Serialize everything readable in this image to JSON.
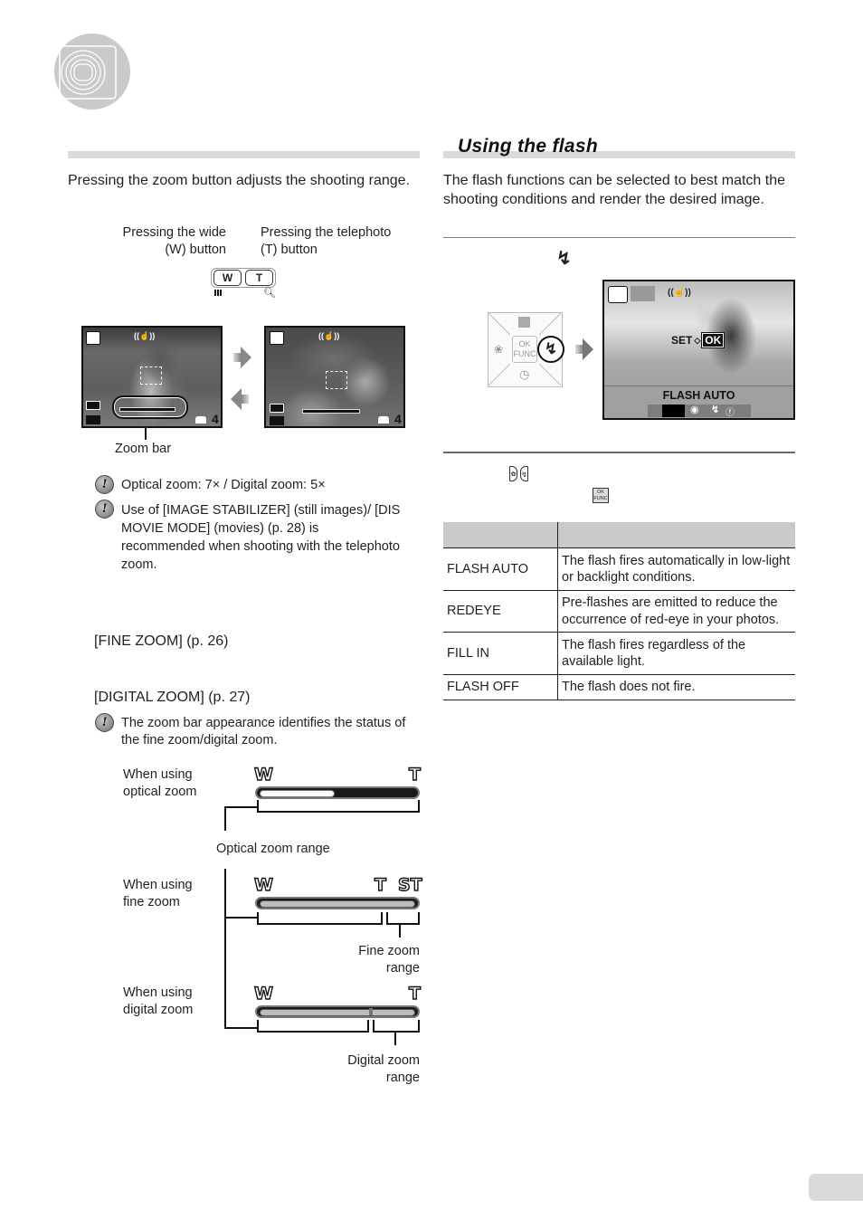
{
  "page": {
    "chapter_icon": "camera-lens-icon",
    "page_tab": ""
  },
  "left": {
    "intro": "Pressing the zoom button adjusts the shooting range.",
    "wide_caption_line1": "Pressing the wide",
    "wide_caption_line2": "(W) button",
    "tele_caption_line1": "Pressing the telephoto",
    "tele_caption_line2": "(T) button",
    "w_key": "W",
    "t_key": "T",
    "screen_count_1": "4",
    "screen_count_2": "4",
    "zoom_bar_label": "Zoom bar",
    "notes": [
      "Optical zoom: 7× / Digital zoom: 5×",
      "Use of [IMAGE STABILIZER] (still images)/ [DIS MOVIE MODE] (movies) (p. 28) is recommended when shooting with the telephoto zoom."
    ],
    "fine_zoom_ref": "[FINE ZOOM] (p. 26)",
    "digital_zoom_ref": "[DIGITAL ZOOM] (p. 27)",
    "zoom_bar_note": "The zoom bar appearance identifies the status of the fine zoom/digital zoom.",
    "diagram": {
      "optical_label_1": "When using",
      "optical_label_2": "optical zoom",
      "optical_range": "Optical zoom range",
      "fine_label_1": "When using",
      "fine_label_2": "fine zoom",
      "fine_range_1": "Fine zoom",
      "fine_range_2": "range",
      "digital_label_1": "When using",
      "digital_label_2": "digital zoom",
      "digital_range_1": "Digital zoom",
      "digital_range_2": "range",
      "w": "W",
      "t": "T",
      "st": "ST",
      "optical_fill_fraction": 0.47
    }
  },
  "right": {
    "title": "Using the flash",
    "intro": "The flash functions can be selected to best match the shooting conditions and render the desired image.",
    "step1_icon": "flash-icon",
    "pad": {
      "ok": "OK",
      "func": "FUNC"
    },
    "screen": {
      "set_label": "SET",
      "ok_label": "OK",
      "mode_label": "FLASH AUTO"
    },
    "table": {
      "headers": [
        "",
        ""
      ],
      "rows": [
        {
          "mode": "FLASH AUTO",
          "desc": "The flash fires automatically in low-light or backlight conditions."
        },
        {
          "mode": "REDEYE",
          "desc": "Pre-flashes are emitted to reduce the occurrence of red-eye in your photos."
        },
        {
          "mode": "FILL IN",
          "desc": "The flash fires regardless of the available light."
        },
        {
          "mode": "FLASH OFF",
          "desc": "The flash does not fire."
        }
      ]
    },
    "ok_func_mini": {
      "line1": "OK",
      "line2": "FUNC"
    }
  }
}
